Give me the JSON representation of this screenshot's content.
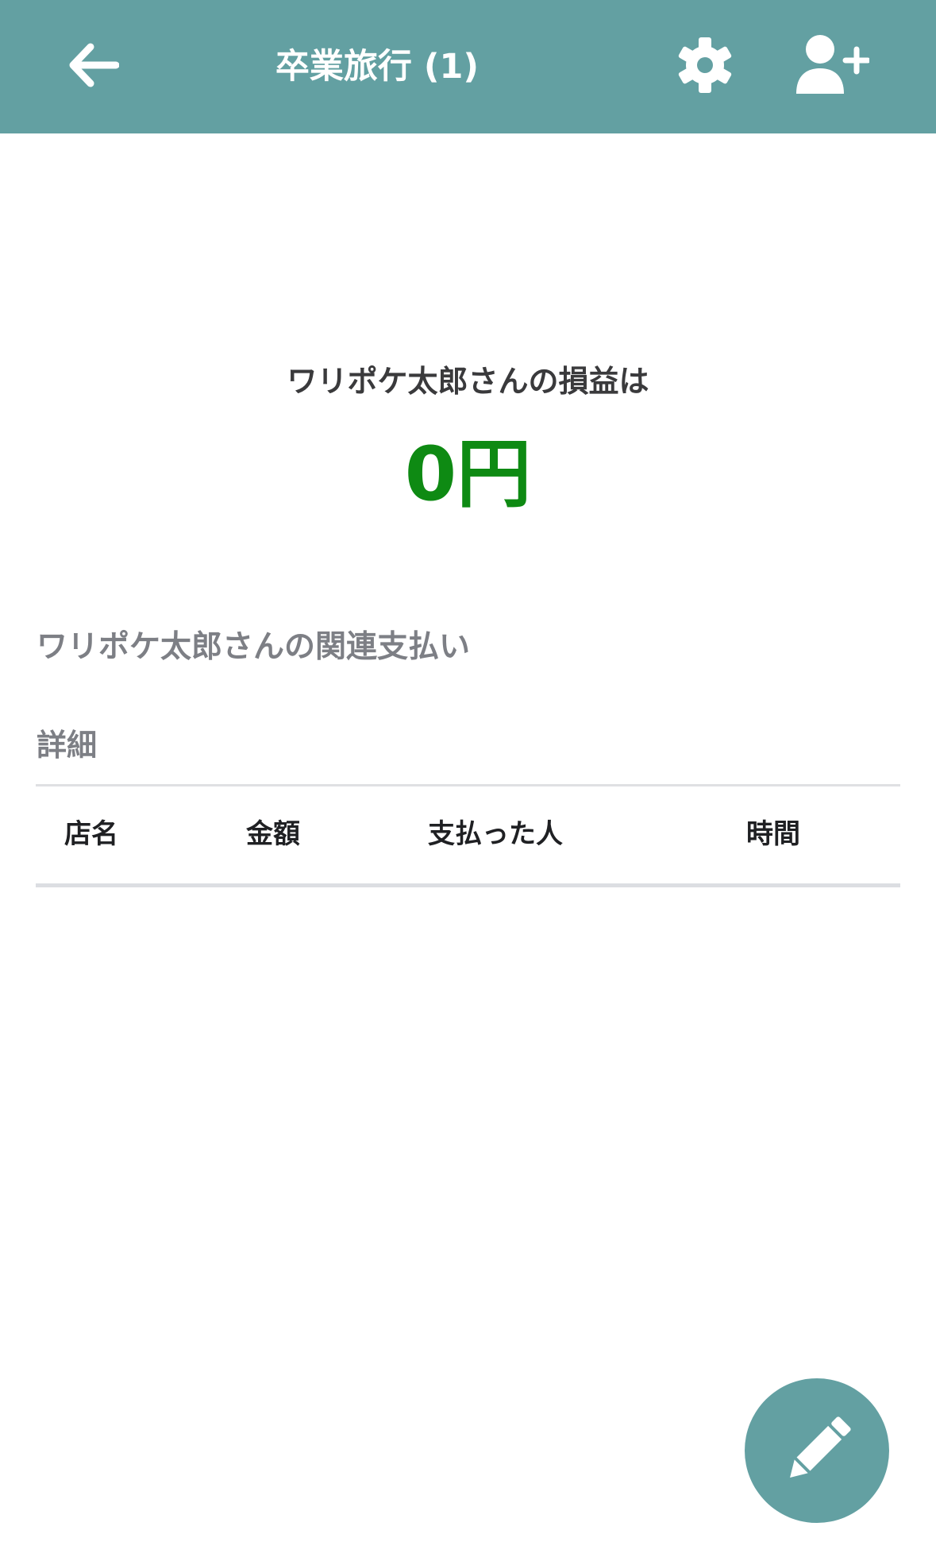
{
  "header": {
    "back_icon": "arrow-left-icon",
    "title": "卒業旅行 (1)",
    "settings_icon": "gear-icon",
    "add_user_icon": "user-plus-icon",
    "background_color": "#63a0a2"
  },
  "profit_loss": {
    "caption": "ワリポケ太郎さんの損益は",
    "amount": "0円",
    "amount_color": "#0e8a13"
  },
  "related_payments": {
    "heading": "ワリポケ太郎さんの関連支払い",
    "details_label": "詳細",
    "columns": [
      "店名",
      "金額",
      "支払った人",
      "時間"
    ],
    "rows": []
  },
  "fab": {
    "icon": "pencil-icon",
    "color": "#63a0a2"
  }
}
